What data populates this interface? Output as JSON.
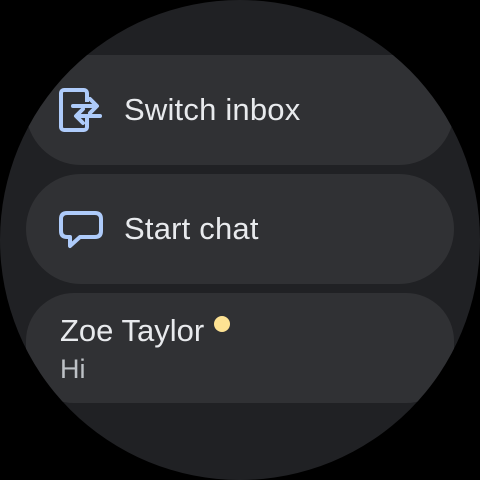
{
  "colors": {
    "background": "#000000",
    "screen": "#202124",
    "chip": "#303134",
    "text_primary": "#e8eaed",
    "text_secondary": "#bdc1c6",
    "icon_accent": "#aecbfa",
    "unread_dot": "#fde293"
  },
  "menu": {
    "switch_inbox": {
      "label": "Switch inbox",
      "icon": "switch-inbox-icon"
    },
    "start_chat": {
      "label": "Start chat",
      "icon": "chat-bubble-icon"
    }
  },
  "conversations": [
    {
      "name": "Zoe Taylor",
      "snippet": "Hi",
      "unread": true
    }
  ]
}
